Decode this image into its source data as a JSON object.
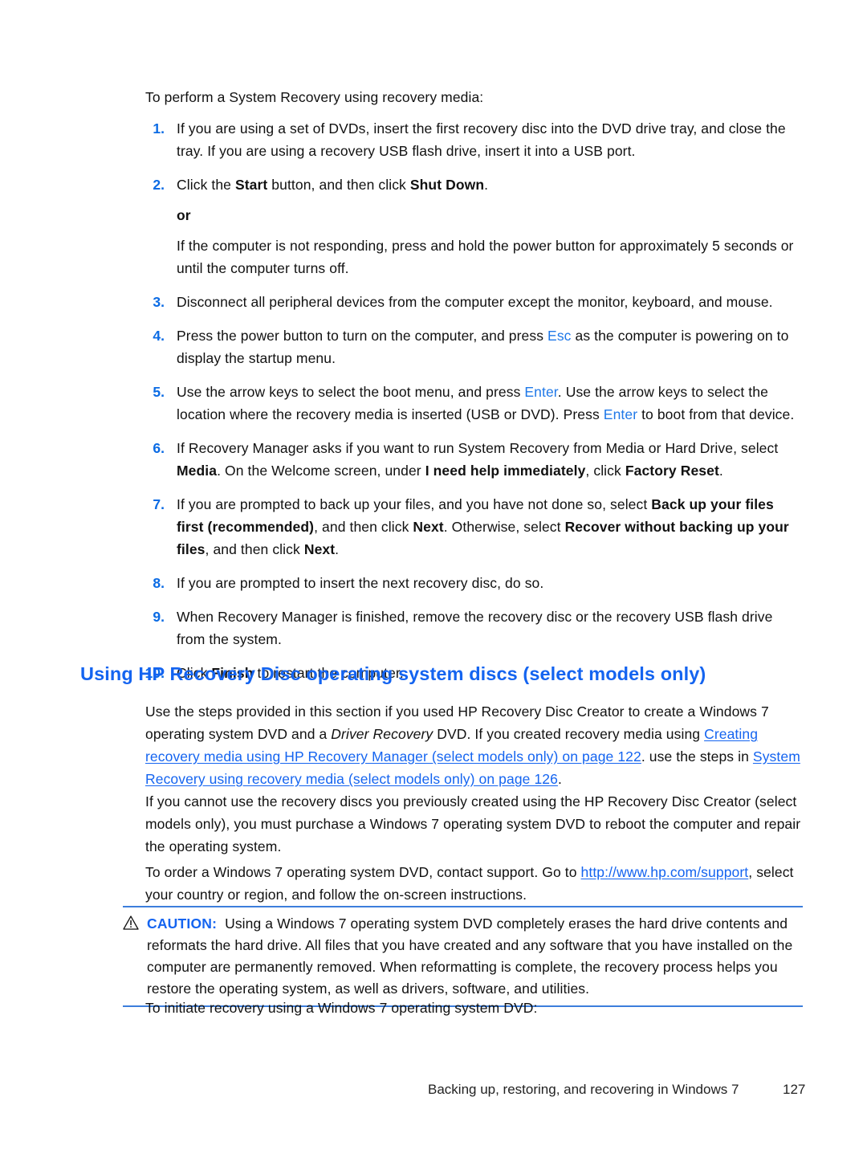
{
  "page": {
    "intro_line": "To perform a System Recovery using recovery media:",
    "steps": [
      {
        "num": "1.",
        "text_before": "If you are using a set of DVDs, insert the first recovery disc into the DVD drive tray, and close the tray. If you are using a recovery USB flash drive, insert it into a USB port."
      },
      {
        "num": "2.",
        "p1": "Click the ",
        "b1": "Start",
        "p2": " button, and then click ",
        "b2": "Shut Down",
        "p3": ".",
        "or_label": "or",
        "sub_text": "If the computer is not responding, press and hold the power button for approximately 5 seconds or until the computer turns off."
      },
      {
        "num": "3.",
        "text_before": "Disconnect all peripheral devices from the computer except the monitor, keyboard, and mouse."
      },
      {
        "num": "4.",
        "p1": "Press the power button to turn on the computer, and press ",
        "k1": "Esc",
        "p2": " as the computer is powering on to display the startup menu."
      },
      {
        "num": "5.",
        "p1": "Use the arrow keys to select the boot menu, and press ",
        "k1": "Enter",
        "p2": ". Use the arrow keys to select the location where the recovery media is inserted (USB or DVD). Press ",
        "k2": "Enter",
        "p3": " to boot from that device."
      },
      {
        "num": "6.",
        "p1": "If Recovery Manager asks if you want to run System Recovery from Media or Hard Drive, select ",
        "b1": "Media",
        "p2": ". On the Welcome screen, under ",
        "b2": "I need help immediately",
        "p3": ", click ",
        "b3": "Factory Reset",
        "p4": "."
      },
      {
        "num": "7.",
        "p1": "If you are prompted to back up your files, and you have not done so, select ",
        "b1": "Back up your files first (recommended)",
        "p2": ", and then click ",
        "b2": "Next",
        "p3": ". Otherwise, select ",
        "b3": "Recover without backing up your files",
        "p4": ", and then click ",
        "b4": "Next",
        "p5": "."
      },
      {
        "num": "8.",
        "text_before": "If you are prompted to insert the next recovery disc, do so."
      },
      {
        "num": "9.",
        "text_before": "When Recovery Manager is finished, remove the recovery disc or the recovery USB flash drive from the system."
      },
      {
        "num": "10.",
        "p1": "Click ",
        "b1": "Finish",
        "p2": " to restart the computer."
      }
    ],
    "section_heading": "Using HP Recovery Disc operating system discs (select models only)",
    "para_1": {
      "t1": "Use the steps provided in this section if you used HP Recovery Disc Creator to create a Windows 7 operating system DVD and a ",
      "i1": "Driver Recovery",
      "t2": " DVD. If you created recovery media using ",
      "link1": "Creating recovery media using HP Recovery Manager (select models only) on page 122",
      "t3": ". use the steps in ",
      "link2": "System Recovery using recovery media (select models only) on page 126",
      "t4": "."
    },
    "para_2": "If you cannot use the recovery discs you previously created using the HP Recovery Disc Creator (select models only), you must purchase a Windows 7 operating system DVD to reboot the computer and repair the operating system.",
    "para_3": {
      "t1": "To order a Windows 7 operating system DVD, contact support. Go to ",
      "link1": "http://www.hp.com/support",
      "t2": ", select your country or region, and follow the on-screen instructions."
    },
    "caution": {
      "icon": "warning-triangle-icon",
      "label": "CAUTION:",
      "text": "Using a Windows 7 operating system DVD completely erases the hard drive contents and reformats the hard drive. All files that you have created and any software that you have installed on the computer are permanently removed. When reformatting is complete, the recovery process helps you restore the operating system, as well as drivers, software, and utilities."
    },
    "para_4": "To initiate recovery using a Windows 7 operating system DVD:",
    "footer": {
      "title": "Backing up, restoring, and recovering in Windows 7",
      "page_number": "127"
    },
    "colors": {
      "list_number_blue": "#0B6BE4",
      "heading_blue": "#1464F0",
      "link_blue": "#1464F0",
      "keycap_blue": "#1F78E8",
      "rule_blue": "#3C7EDC",
      "body_text": "#111111",
      "background": "#ffffff"
    }
  }
}
